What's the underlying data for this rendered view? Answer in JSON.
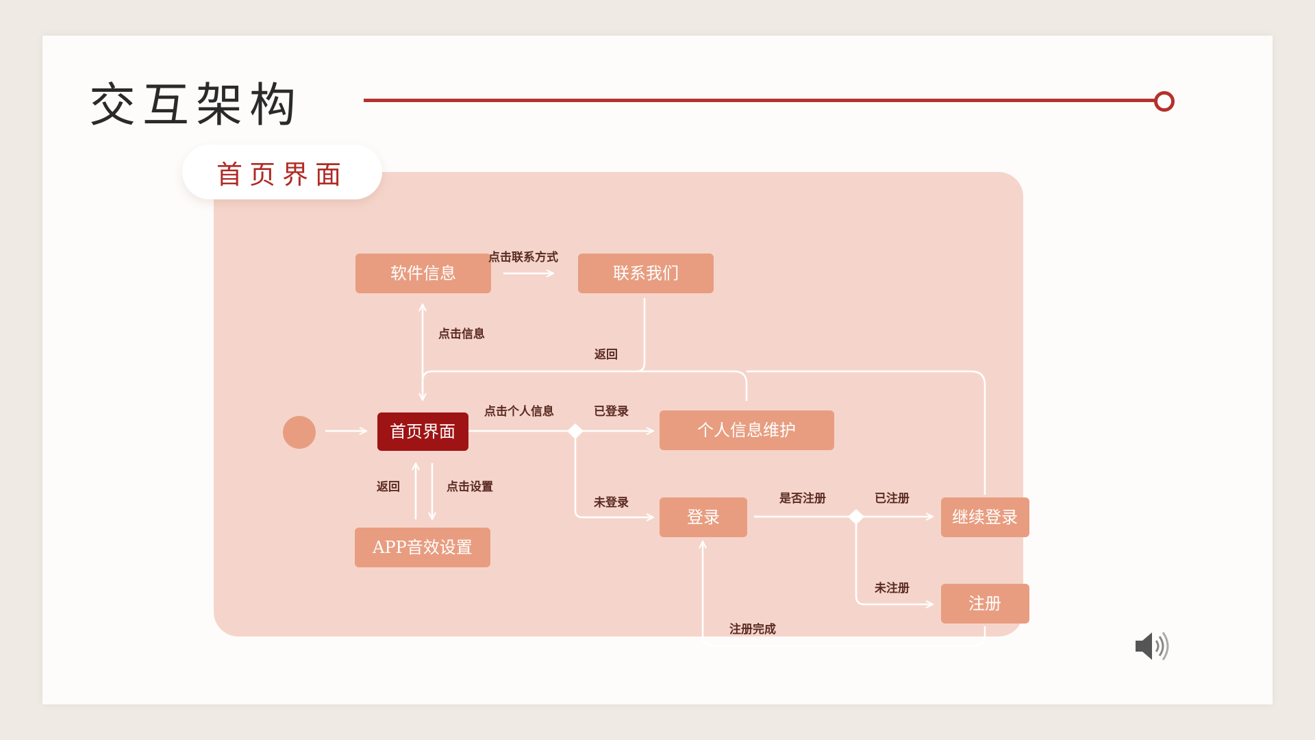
{
  "slide": {
    "title": "交互架构",
    "section_label": "首页界面"
  },
  "colors": {
    "accent_red": "#b5312c",
    "panel_fill": "#f5d5cb",
    "node_fill": "#e89d80",
    "home_node_fill": "#9e1414",
    "connector": "#ffffff"
  },
  "nodes": {
    "software_info": "软件信息",
    "contact_us": "联系我们",
    "home": "首页界面",
    "profile": "个人信息维护",
    "sound_settings": "APP音效设置",
    "login": "登录",
    "continue_login": "继续登录",
    "register": "注册"
  },
  "edges": {
    "click_contact": "点击联系方式",
    "click_info": "点击信息",
    "back_from_contact": "返回",
    "click_personal": "点击个人信息",
    "logged_in": "已登录",
    "not_logged_in": "未登录",
    "back_from_settings": "返回",
    "click_settings": "点击设置",
    "is_registered_q": "是否注册",
    "registered": "已注册",
    "not_registered": "未注册",
    "register_done": "注册完成"
  },
  "icons": {
    "start": "start-node-circle",
    "speaker": "speaker-icon"
  }
}
